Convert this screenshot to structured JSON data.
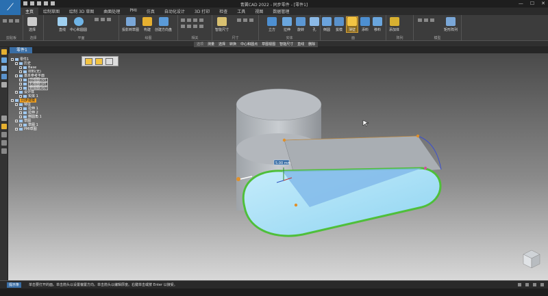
{
  "app": {
    "title": "青翼CAD 2022 - 同步零件 - [零件1]",
    "logo_glyph": "⟋"
  },
  "menu_tabs": [
    "主页",
    "绘制草图",
    "绘制 3D 草图",
    "曲面处理",
    "PMI",
    "仿真",
    "自动化设计",
    "3D 打印",
    "检查",
    "工具",
    "视图",
    "数据管理"
  ],
  "ribbon": {
    "groups": [
      {
        "label": "剪贴板"
      },
      {
        "label": "选择"
      },
      {
        "label": "平面"
      },
      {
        "label": "绘图"
      },
      {
        "label": "相关"
      },
      {
        "label": "尺寸"
      },
      {
        "label": "实体"
      },
      {
        "label": "面"
      },
      {
        "label": "阵列"
      },
      {
        "label": "模型"
      }
    ],
    "buttons": {
      "select": "选择",
      "line": "直线",
      "center_circle": "中心和圆圆",
      "projection": "投影到草图",
      "trim": "构建",
      "create_3d": "创建方向盘",
      "smart_dim": "智能尺寸",
      "cube": "立方",
      "extrude": "拉伸",
      "revolve": "旋转",
      "hole": "孔",
      "round": "倒圆",
      "draft": "拔模",
      "thin_wall": "薄壁",
      "rib": "添料",
      "offset": "移料",
      "add_body": "添加体",
      "pattern": "矩形阵列",
      "mirror": "镜像"
    }
  },
  "command_bar": {
    "items": [
      "选项",
      "测量",
      "选择",
      "转换",
      "中心和圆点",
      "草图视图",
      "智能尺寸",
      "直线",
      "删除"
    ],
    "selected": "薄壁"
  },
  "document_tab": "零件1",
  "tree": [
    {
      "text": "零件1",
      "indent": 0
    },
    {
      "text": "历史",
      "indent": 1
    },
    {
      "text": "Base",
      "indent": 2
    },
    {
      "text": "材料(无)",
      "indent": 2
    },
    {
      "text": "基本参考平面",
      "indent": 1
    },
    {
      "text": "前视图(xz)",
      "indent": 2,
      "boxed": true
    },
    {
      "text": "右视图(yz)",
      "indent": 2,
      "boxed": true
    },
    {
      "text": "俯视图(xy)",
      "indent": 2,
      "boxed": true
    },
    {
      "text": "设计体",
      "indent": 1
    },
    {
      "text": "实体 1",
      "indent": 2
    },
    {
      "text": "同步建模",
      "indent": 0,
      "highlight": true
    },
    {
      "text": "特征",
      "indent": 1
    },
    {
      "text": "拉伸 1",
      "indent": 2
    },
    {
      "text": "拉伸 2",
      "indent": 2
    },
    {
      "text": "倒圆角 1",
      "indent": 2
    },
    {
      "text": "草图",
      "indent": 1
    },
    {
      "text": "草图 1",
      "indent": 2
    },
    {
      "text": "PMI草图",
      "indent": 1
    }
  ],
  "status": {
    "label": "提示条",
    "text": "单击要打开的面。单击箭头以设置偏置方向。单击箭头以编辑厚度。右键单击或按 Enter 以接受。",
    "dim_value": "5.00 mm"
  },
  "colors": {
    "accent": "#3a6ea5",
    "highlight": "#f0a020",
    "selected_face": "#a8e0f5",
    "green_edge": "#4fbf3a"
  }
}
